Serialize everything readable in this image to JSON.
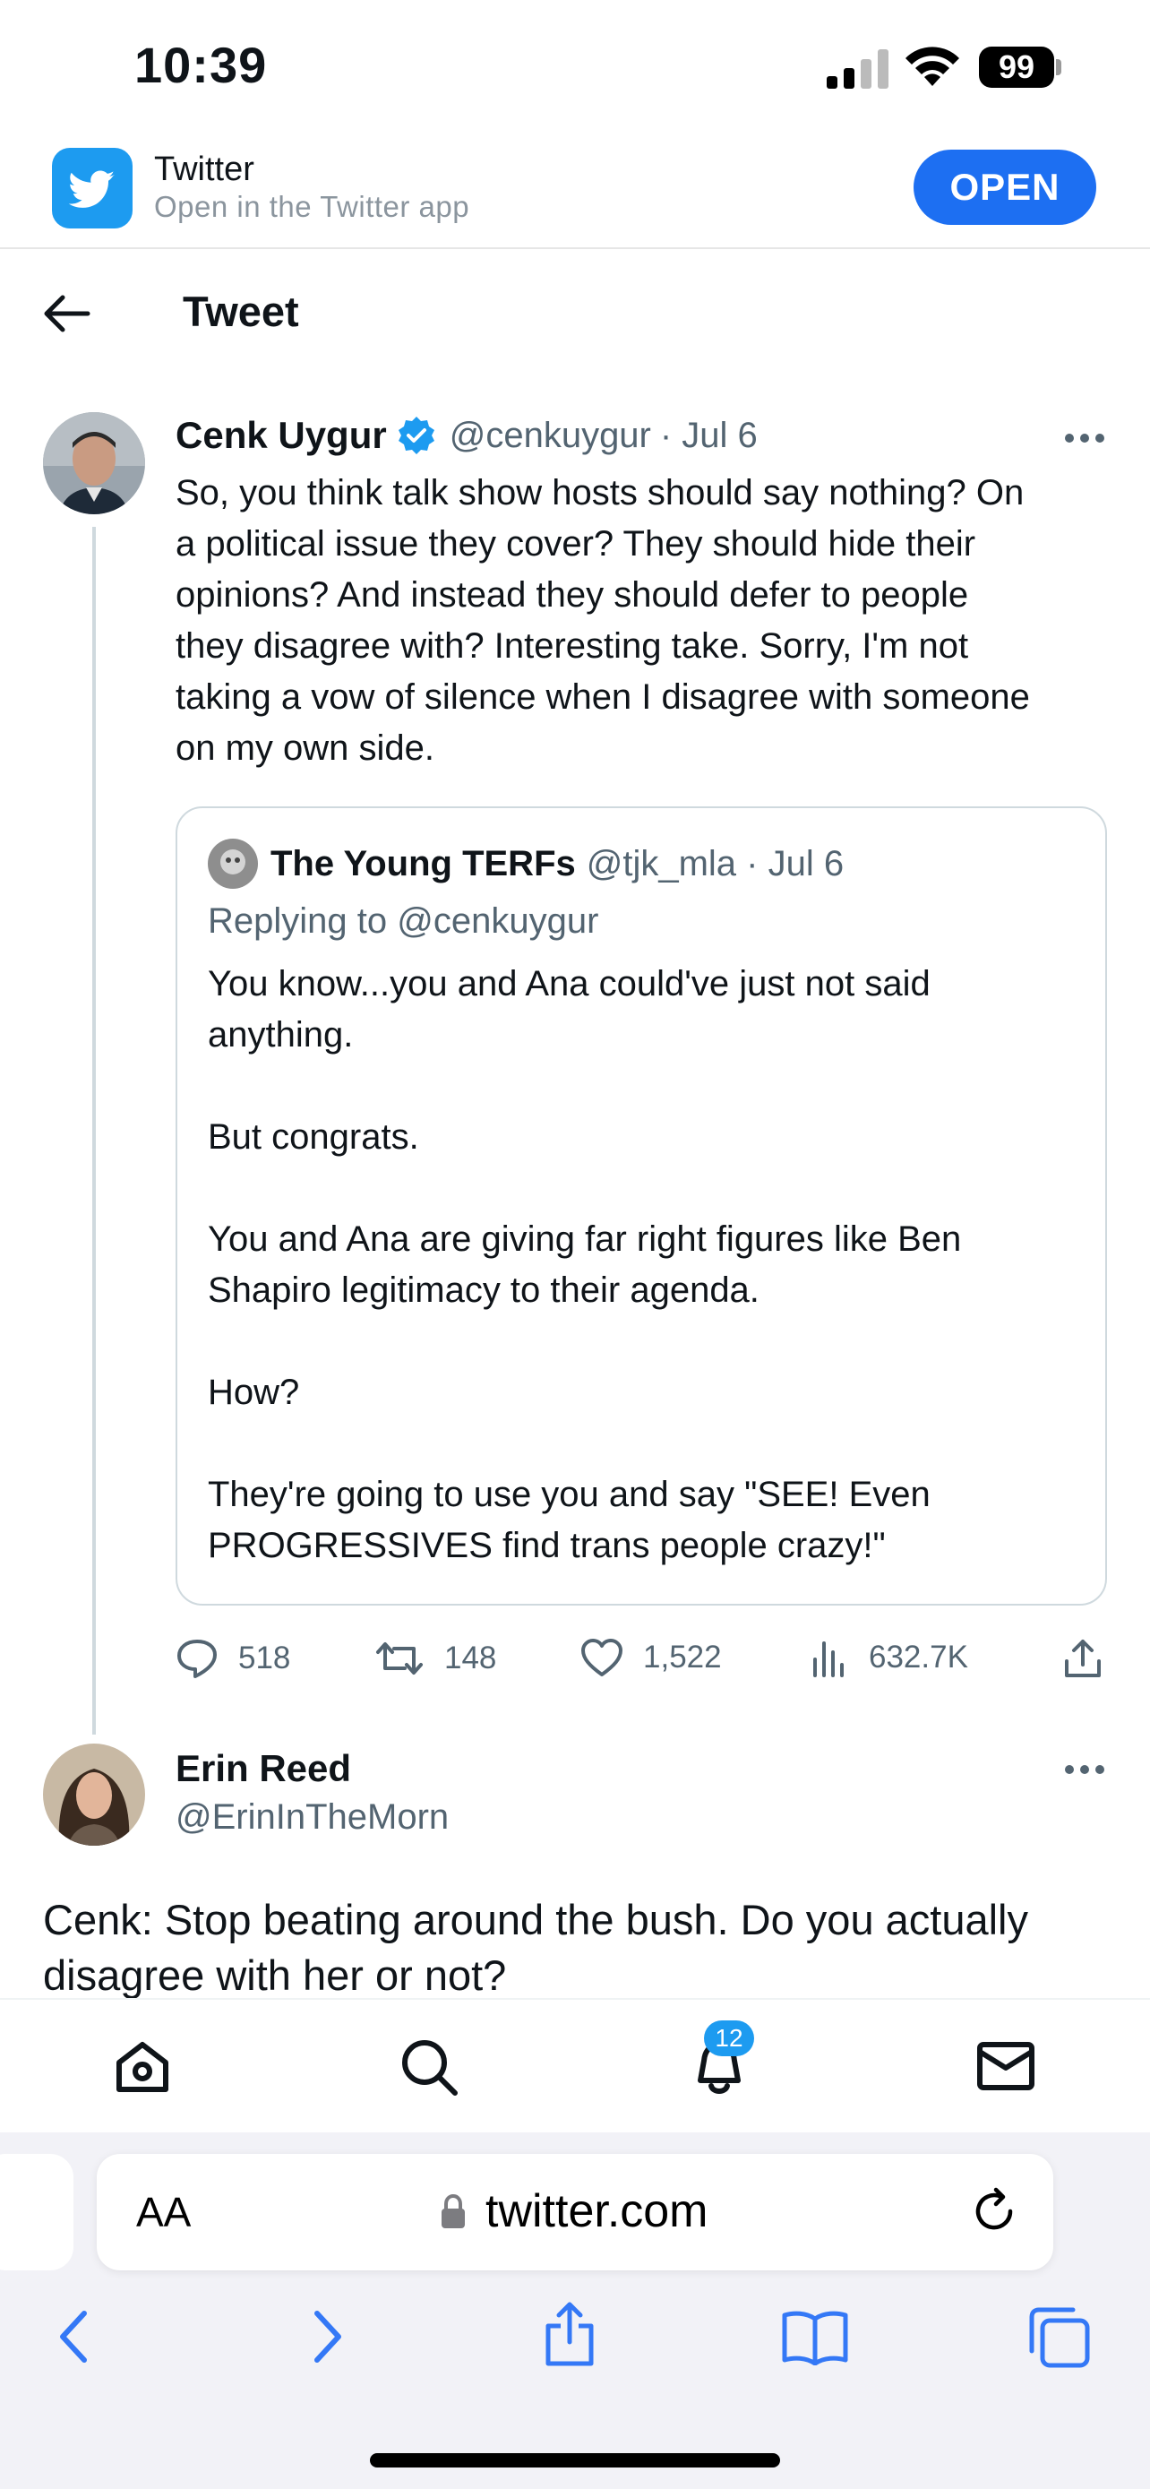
{
  "status_bar": {
    "time": "10:39",
    "battery": "99"
  },
  "app_banner": {
    "title": "Twitter",
    "subtitle": "Open in the Twitter app",
    "open_label": "OPEN"
  },
  "header": {
    "title": "Tweet"
  },
  "main_tweet": {
    "name": "Cenk Uygur",
    "handle": "@cenkuygur",
    "date": "· Jul 6",
    "lines": [
      "So, you think talk show hosts should say nothing? On",
      "a political issue they cover? They should hide their",
      "opinions? And instead they should defer to people",
      "they disagree with? Interesting take. Sorry, I'm not",
      "taking a vow of silence when I disagree with someone",
      "on my own side."
    ],
    "quote": {
      "name": "The Young TERFs",
      "handle": "@tjk_mla · Jul 6",
      "replying": "Replying to @cenkuygur",
      "lines": [
        "You know...you and Ana could've just not said",
        "anything.",
        "",
        "But congrats.",
        "",
        "You and Ana are giving far right figures like Ben",
        "Shapiro legitimacy to their agenda.",
        "",
        "How?",
        "",
        "They're going to use you and say \"SEE! Even",
        "PROGRESSIVES find trans people crazy!\""
      ]
    },
    "stats": {
      "replies": "518",
      "retweets": "148",
      "likes": "1,522",
      "views": "632.7K"
    }
  },
  "reply_tweet": {
    "name": "Erin Reed",
    "handle": "@ErinInTheMorn",
    "text_line1": "Cenk: Stop beating around the bush. Do you actually",
    "text_line2": "disagree with her or not?"
  },
  "tab_bar": {
    "notifications_badge": "12"
  },
  "safari": {
    "aa_label": "AA",
    "url": "twitter.com"
  },
  "colors": {
    "twitter_blue": "#1d9bf0",
    "open_button": "#1d6ff2",
    "verified": "#1d9bf0",
    "safari_blue": "#3478f6"
  }
}
